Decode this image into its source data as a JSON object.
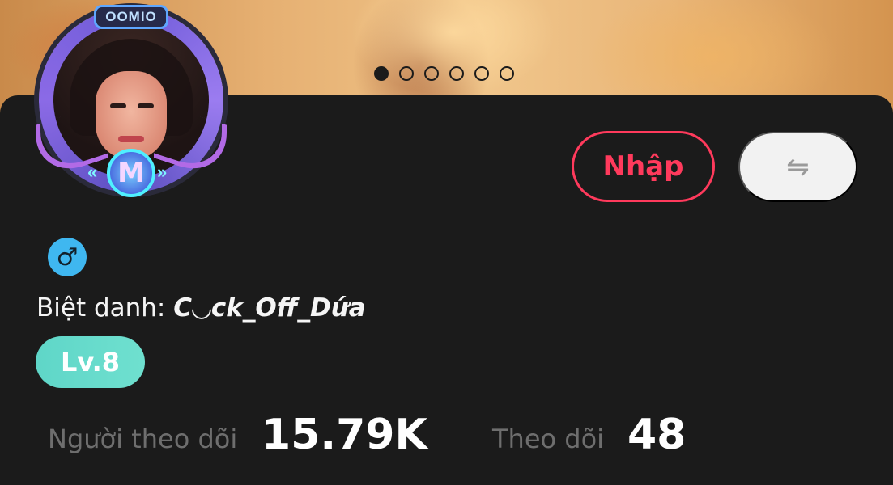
{
  "banner": {
    "carousel_total": 6,
    "carousel_active": 1
  },
  "avatar": {
    "frame_label": "OOMIO",
    "badge_letter": "M"
  },
  "actions": {
    "enter_label": "Nhập",
    "switch_icon": "swap-arrows-icon",
    "enter_color": "#ff3a5c"
  },
  "profile": {
    "gender_icon": "male-icon",
    "gender_symbol": "♂",
    "nickname_label": "Biệt danh:",
    "nickname_value": "C◡ck_Off_Dứa",
    "level": "Lv.8",
    "level_color": "#5fd6c8"
  },
  "stats": {
    "followers_label": "Người theo dõi",
    "followers_value": "15.79K",
    "following_label": "Theo dõi",
    "following_value": "48"
  }
}
